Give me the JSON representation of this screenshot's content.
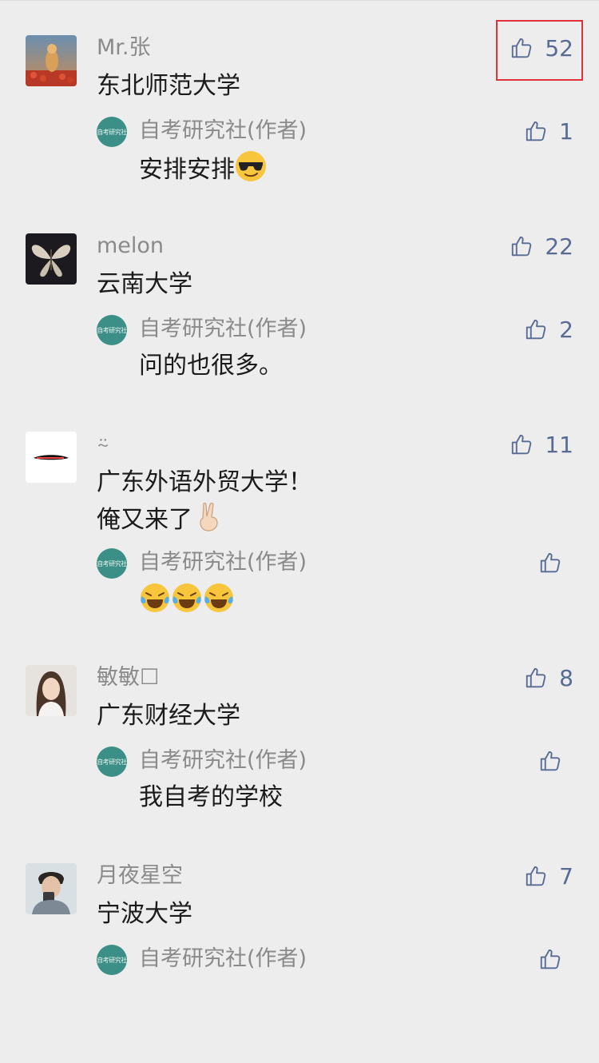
{
  "comments": [
    {
      "name": "Mr.张",
      "text": "东北师范大学",
      "likes": "52",
      "avatar": "astronaut-photo",
      "reply": {
        "name": "自考研究社(作者)",
        "text": "安排安排",
        "emoji": "sunglasses-emoji",
        "likes": "1",
        "avatar_text": "自考研究社"
      }
    },
    {
      "name": "melon",
      "text": "云南大学",
      "likes": "22",
      "avatar": "butterfly-photo",
      "reply": {
        "name": "自考研究社(作者)",
        "text": "问的也很多。",
        "likes": "2",
        "avatar_text": "自考研究社"
      }
    },
    {
      "name": "⍨",
      "text_lines": [
        "广东外语外贸大学！",
        "俺又来了"
      ],
      "line2_emoji": "victory-hand-emoji",
      "likes": "11",
      "avatar": "mustache-drawing",
      "reply": {
        "name": "自考研究社(作者)",
        "emoji": "tears-of-joy-emoji x3",
        "likes": "",
        "avatar_text": "自考研究社"
      }
    },
    {
      "name": "敏敏☐",
      "text": "广东财经大学",
      "likes": "8",
      "avatar": "woman-portrait",
      "reply": {
        "name": "自考研究社(作者)",
        "text": "我自考的学校",
        "likes": "",
        "avatar_text": "自考研究社"
      }
    },
    {
      "name": "月夜星空",
      "text": "宁波大学",
      "likes": "7",
      "avatar": "man-selfie",
      "reply": {
        "name": "自考研究社(作者)",
        "likes": "",
        "avatar_text": "自考研究社"
      }
    }
  ],
  "colors": {
    "background": "#ededed",
    "link_blue": "#576b95",
    "highlight_red": "#e0313a",
    "reply_avatar": "#3b8f86"
  }
}
